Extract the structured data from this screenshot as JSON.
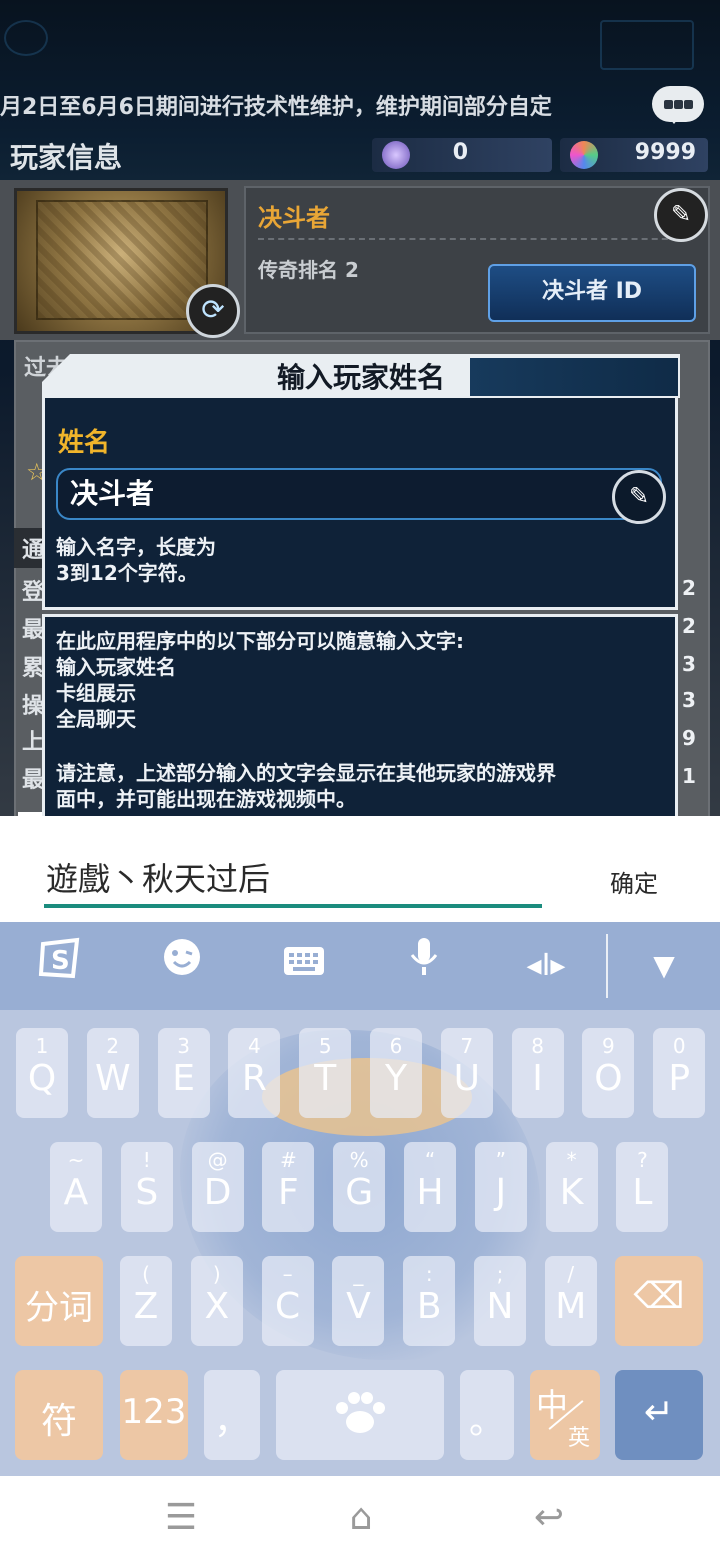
{
  "game": {
    "ticker": "月2日至6月6日期间进行技术性维护，维护期间部分自定",
    "page_title": "玩家信息",
    "currency_1": "0",
    "currency_2": "9999",
    "player_name": "决斗者",
    "rank_label": "传奇排名 2",
    "id_button": "决斗者 ID",
    "past_label": "过去",
    "left_labels": [
      "通",
      "登",
      "最",
      "累",
      "操",
      "上",
      "最"
    ],
    "right_values": [
      "2",
      "2",
      "3",
      "3",
      "9",
      "1"
    ]
  },
  "dialog": {
    "title": "输入玩家姓名",
    "name_label": "姓名",
    "name_value": "决斗者",
    "hint_line1": "输入名字，长度为",
    "hint_line2": "3到12个字符。",
    "notice_line1": "在此应用程序中的以下部分可以随意输入文字:",
    "notice_line2": "输入玩家姓名",
    "notice_line3": "卡组展示",
    "notice_line4": "全局聊天",
    "notice_line5": "请注意，上述部分输入的文字会显示在其他玩家的游戏界",
    "notice_line6": "面中，并可能出现在游戏视频中。"
  },
  "ime": {
    "text": "遊戲丶秋天过后",
    "confirm": "确定"
  },
  "keyboard": {
    "row1": [
      {
        "k": "Q",
        "h": "1"
      },
      {
        "k": "W",
        "h": "2"
      },
      {
        "k": "E",
        "h": "3"
      },
      {
        "k": "R",
        "h": "4"
      },
      {
        "k": "T",
        "h": "5"
      },
      {
        "k": "Y",
        "h": "6"
      },
      {
        "k": "U",
        "h": "7"
      },
      {
        "k": "I",
        "h": "8"
      },
      {
        "k": "O",
        "h": "9"
      },
      {
        "k": "P",
        "h": "0"
      }
    ],
    "row2": [
      {
        "k": "A",
        "h": "~"
      },
      {
        "k": "S",
        "h": "!"
      },
      {
        "k": "D",
        "h": "@"
      },
      {
        "k": "F",
        "h": "#"
      },
      {
        "k": "G",
        "h": "%"
      },
      {
        "k": "H",
        "h": "“"
      },
      {
        "k": "J",
        "h": "”"
      },
      {
        "k": "K",
        "h": "*"
      },
      {
        "k": "L",
        "h": "?"
      }
    ],
    "row3": [
      {
        "k": "Z",
        "h": "("
      },
      {
        "k": "X",
        "h": ")"
      },
      {
        "k": "C",
        "h": "–"
      },
      {
        "k": "V",
        "h": "_"
      },
      {
        "k": "B",
        "h": ":"
      },
      {
        "k": "N",
        "h": ";"
      },
      {
        "k": "M",
        "h": "/"
      }
    ],
    "split_word": "分词",
    "symbols": "符",
    "numbers": "123",
    "comma": "，",
    "period": "。",
    "lang_zh": "中",
    "lang_en": "英",
    "toolbar_icons": [
      "sogou-logo-icon",
      "emoji-icon",
      "keyboard-icon",
      "microphone-icon",
      "cursor-icon",
      "collapse-icon"
    ]
  },
  "colors": {
    "accent_orange": "#f1b52b",
    "ime_underline": "#1b8c7e",
    "keyboard_bg": "#b9c6df",
    "orange_key": "#edc7a5",
    "enter_key": "#6f8fc0"
  }
}
